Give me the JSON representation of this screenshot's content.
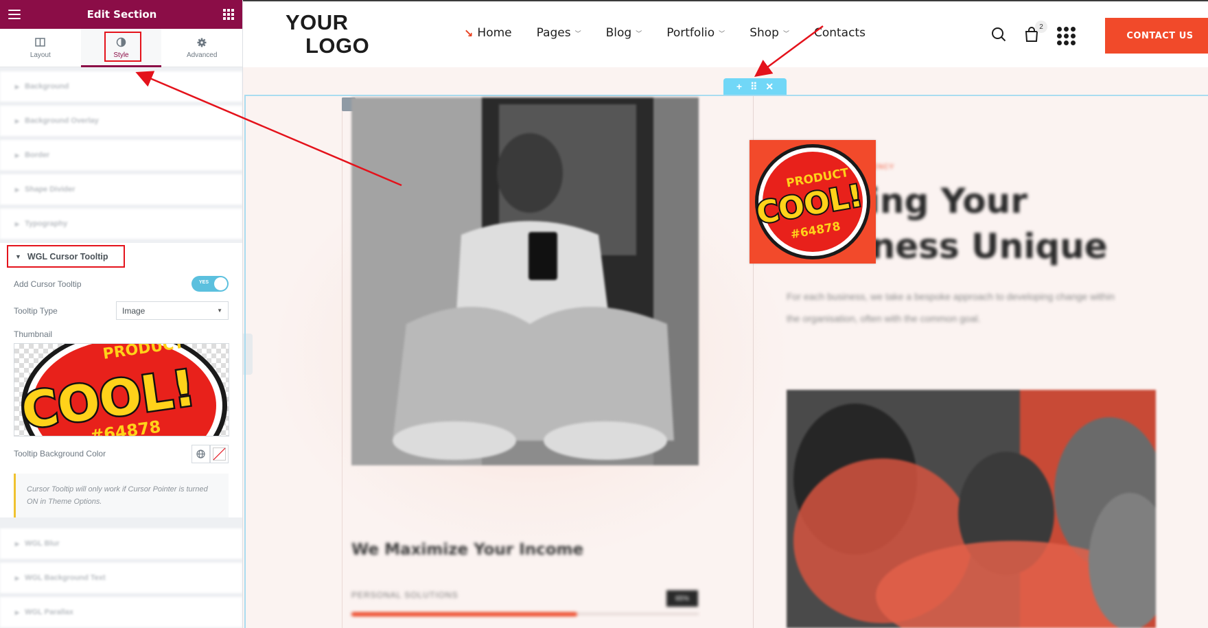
{
  "panel": {
    "title": "Edit Section",
    "tabs": [
      {
        "label": "Layout",
        "icon": "layout-icon"
      },
      {
        "label": "Style",
        "icon": "contrast-icon"
      },
      {
        "label": "Advanced",
        "icon": "gear-icon"
      }
    ],
    "active_tab": "Style",
    "collapsed_sections_top": [
      "Background",
      "Background Overlay",
      "Border",
      "Shape Divider",
      "Typography"
    ],
    "open_section": {
      "title": "WGL Cursor Tooltip",
      "add_tooltip_label": "Add Cursor Tooltip",
      "add_tooltip_toggle": "YES",
      "tooltip_type_label": "Tooltip Type",
      "tooltip_type_value": "Image",
      "thumbnail_label": "Thumbnail",
      "bg_color_label": "Tooltip Background Color",
      "note": "Cursor Tooltip will only work if Cursor Pointer is turned ON in Theme Options."
    },
    "collapsed_sections_bottom": [
      "WGL Blur",
      "WGL Background Text",
      "WGL Parallax"
    ],
    "accent_color": "#8b0d47"
  },
  "site": {
    "logo_line1": "YOUR",
    "logo_line2": "LOGO",
    "nav": [
      {
        "label": "Home",
        "active": true
      },
      {
        "label": "Pages",
        "dropdown": true
      },
      {
        "label": "Blog",
        "dropdown": true
      },
      {
        "label": "Portfolio",
        "dropdown": true
      },
      {
        "label": "Shop",
        "dropdown": true
      },
      {
        "label": "Contacts"
      }
    ],
    "cart_count": "2",
    "contact_button": "CONTACT US",
    "brand_color": "#f14a2a"
  },
  "content": {
    "kicker": "AGENCY",
    "hero_line1": "Making Your",
    "hero_line2": "Business Unique",
    "description": "For each business, we take a bespoke approach to developing change within the organisation, often with the common goal.",
    "income_title": "We Maximize Your Income",
    "skill_label": "PERSONAL SOLUTIONS",
    "skill_value": "65%",
    "skill_fraction": 0.65
  },
  "sticker": {
    "top": "PRODUCT",
    "main": "COOL!",
    "bottom": "#64878"
  }
}
